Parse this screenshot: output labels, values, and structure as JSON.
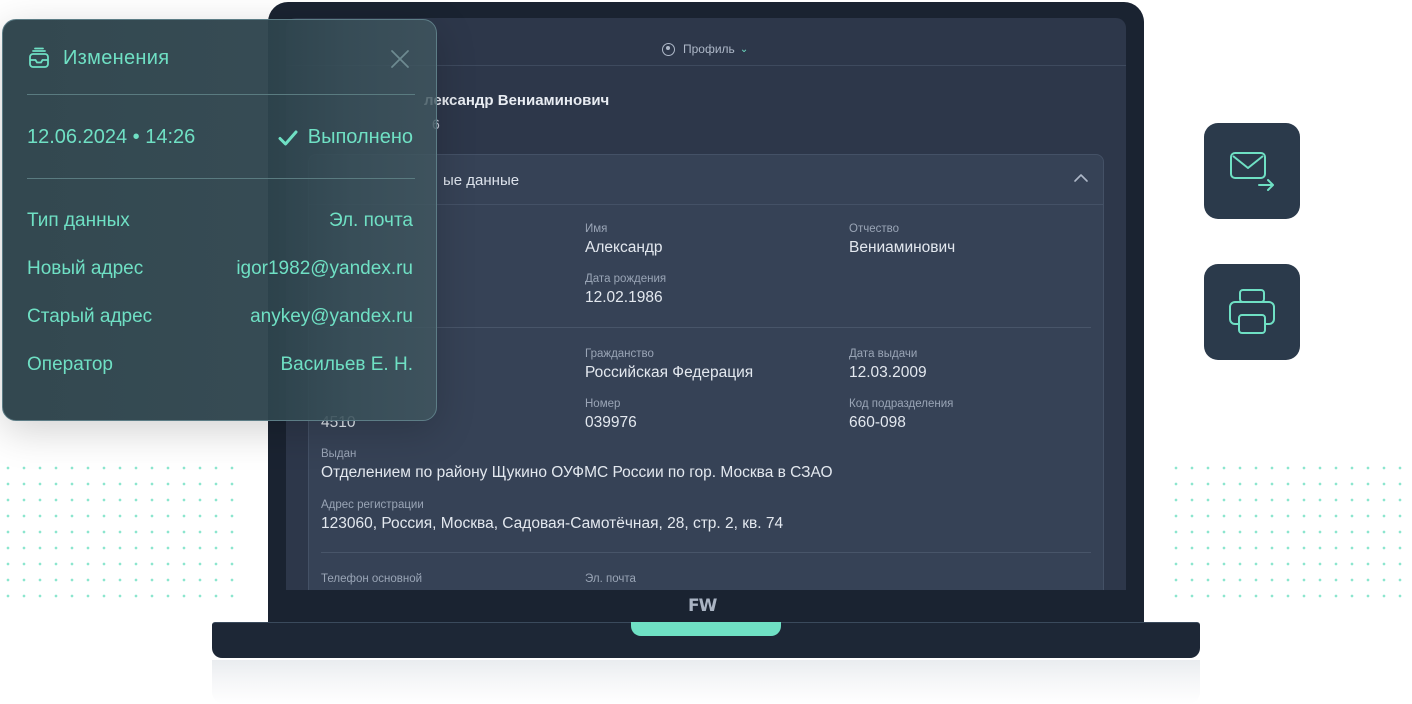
{
  "colors": {
    "accent": "#6fe0c4",
    "screen_bg": "#2d374a",
    "tile_bg": "#2b3a4b",
    "laptop_body": "#1a2331"
  },
  "changes_panel": {
    "icon": "inbox-tray-icon",
    "title": "Изменения",
    "close_icon": "close-icon",
    "date_time": "12.06.2024 • 14:26",
    "status_icon": "checkmark-icon",
    "status": "Выполнено",
    "rows": [
      {
        "label": "Тип данных",
        "value": "Эл. почта"
      },
      {
        "label": "Новый адрес",
        "value": "igor1982@yandex.ru"
      },
      {
        "label": "Старый адрес",
        "value": "anykey@yandex.ru"
      },
      {
        "label": "Оператор",
        "value": "Васильев Е. Н."
      }
    ]
  },
  "screen": {
    "topbar": {
      "profile_label": "Профиль",
      "profile_icon": "user-circle-icon"
    },
    "person_name": "лександр Вениаминович",
    "person_sub": "6",
    "card": {
      "title": "ые данные",
      "collapse_icon": "chevron-up-icon",
      "fields": {
        "first_name": {
          "label": "Имя",
          "value": "Александр"
        },
        "patronymic": {
          "label": "Отчество",
          "value": "Вениаминович"
        },
        "birth_date": {
          "label": "Дата рождения",
          "value": "12.02.1986"
        },
        "citizenship": {
          "label": "Гражданство",
          "value": "Российская Федерация"
        },
        "issue_date": {
          "label": "Дата выдачи",
          "value": "12.03.2009"
        },
        "series": {
          "value": "4510"
        },
        "number": {
          "label": "Номер",
          "value": "039976"
        },
        "division_code": {
          "label": "Код подразделения",
          "value": "660-098"
        },
        "issued_by": {
          "label": "Выдан",
          "value": "Отделением по району Щукино ОУФМС России по гор. Москва в СЗАО"
        },
        "registration_address": {
          "label": "Адрес регистрации",
          "value": "123060, Россия, Москва, Садовая-Самотёчная, 28, стр. 2, кв. 74"
        },
        "phone_main": {
          "label": "Телефон основной"
        },
        "email": {
          "label": "Эл. почта"
        }
      }
    }
  },
  "laptop": {
    "logo": "FW"
  },
  "actions": [
    {
      "name": "send-email",
      "icon": "mail-send-icon"
    },
    {
      "name": "print",
      "icon": "printer-icon"
    }
  ]
}
